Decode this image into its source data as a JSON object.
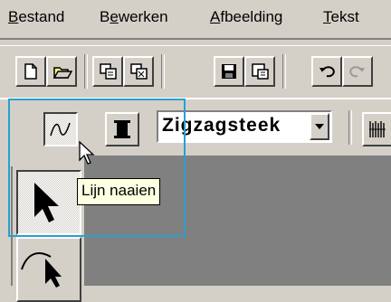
{
  "menubar": {
    "items": [
      {
        "u": "B",
        "rest": "estand"
      },
      {
        "pre": "B",
        "u": "e",
        "rest": "werken"
      },
      {
        "u": "A",
        "rest": "fbeelding"
      },
      {
        "u": "T",
        "rest": "ekst"
      }
    ]
  },
  "stitch_combo": {
    "value": "Zigzagsteek"
  },
  "tooltip": {
    "text": "Lijn naaien"
  },
  "colors": {
    "face": "#d4d0c8",
    "workspace": "#808080",
    "tooltip_bg": "#ffffe1",
    "highlight": "#2a9fd0"
  },
  "icons": [
    "new-document-icon",
    "open-folder-icon",
    "copy-icon",
    "paste-icon",
    "save-icon",
    "save-as-icon",
    "undo-icon",
    "redo-icon",
    "line-stitch-icon",
    "thread-color-icon",
    "satin-pattern-icon",
    "select-arrow-icon",
    "curve-select-icon",
    "mouse-cursor-icon"
  ]
}
